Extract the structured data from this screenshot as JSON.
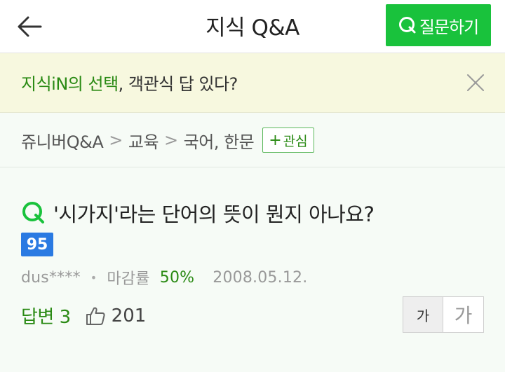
{
  "header": {
    "back_icon": "arrow-left-icon",
    "title": "지식 Q&A",
    "ask_button_label": "질문하기",
    "ask_button_icon": "q-icon"
  },
  "banner": {
    "accent_text": "지식iN의 선택",
    "rest_text": ", 객관식 답 있다?",
    "close_icon": "close-icon"
  },
  "breadcrumb": {
    "items": [
      "쥬니버Q&A",
      "교육",
      "국어, 한문"
    ],
    "separator": ">",
    "follow_label": "관심",
    "follow_prefix": "+"
  },
  "question": {
    "title": "'시가지'라는 단어의 뜻이 뭔지 아나요?",
    "points": "95",
    "author": "dus****",
    "closing_rate_label": "마감률",
    "closing_rate_value": "50%",
    "date": "2008.05.12.",
    "answers_label": "답변 3",
    "likes": "201"
  },
  "font_size_toggle": {
    "small_label": "가",
    "large_label": "가"
  },
  "colors": {
    "brand_green": "#19c23c",
    "accent_green": "#2a8a14",
    "badge_blue": "#2a7ae2",
    "banner_bg": "#f7f8df"
  }
}
